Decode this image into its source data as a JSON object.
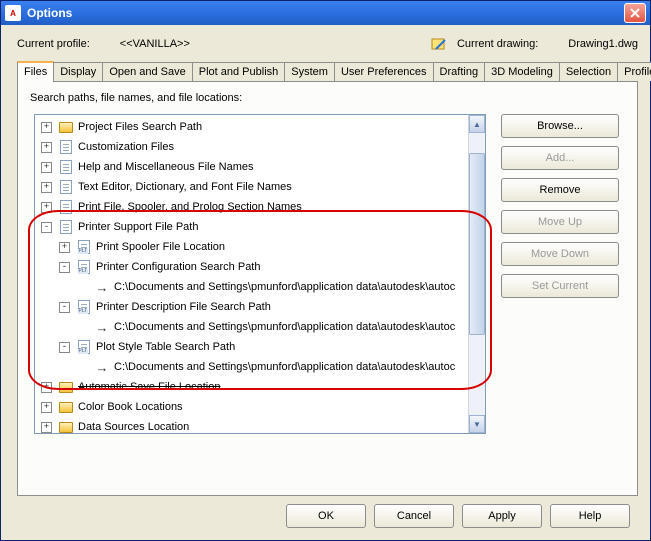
{
  "window": {
    "title": "Options"
  },
  "profile": {
    "label": "Current profile:",
    "name": "<<VANILLA>>",
    "drawing_label": "Current drawing:",
    "drawing_name": "Drawing1.dwg"
  },
  "tabs": [
    {
      "label": "Files",
      "active": true
    },
    {
      "label": "Display"
    },
    {
      "label": "Open and Save"
    },
    {
      "label": "Plot and Publish"
    },
    {
      "label": "System"
    },
    {
      "label": "User Preferences"
    },
    {
      "label": "Drafting"
    },
    {
      "label": "3D Modeling"
    },
    {
      "label": "Selection"
    },
    {
      "label": "Profiles"
    }
  ],
  "panel": {
    "caption": "Search paths, file names, and file locations:"
  },
  "tree": [
    {
      "indent": 0,
      "toggle": "+",
      "icon": "folder-y",
      "label": "Project Files Search Path"
    },
    {
      "indent": 0,
      "toggle": "+",
      "icon": "page",
      "label": "Customization Files"
    },
    {
      "indent": 0,
      "toggle": "+",
      "icon": "page",
      "label": "Help and Miscellaneous File Names"
    },
    {
      "indent": 0,
      "toggle": "+",
      "icon": "page",
      "label": "Text Editor, Dictionary, and Font File Names"
    },
    {
      "indent": 0,
      "toggle": "+",
      "icon": "page",
      "label": "Print File, Spooler, and Prolog Section Names"
    },
    {
      "indent": 0,
      "toggle": "-",
      "icon": "page",
      "label": "Printer Support File Path"
    },
    {
      "indent": 1,
      "toggle": "+",
      "icon": "page-plt",
      "label": "Print Spooler File Location"
    },
    {
      "indent": 1,
      "toggle": "-",
      "icon": "page-plt",
      "label": "Printer Configuration Search Path"
    },
    {
      "indent": 2,
      "toggle": "",
      "icon": "arrow",
      "label": "C:\\Documents and Settings\\pmunford\\application data\\autodesk\\autoc"
    },
    {
      "indent": 1,
      "toggle": "-",
      "icon": "page-plt",
      "label": "Printer Description File Search Path"
    },
    {
      "indent": 2,
      "toggle": "",
      "icon": "arrow",
      "label": "C:\\Documents and Settings\\pmunford\\application data\\autodesk\\autoc"
    },
    {
      "indent": 1,
      "toggle": "-",
      "icon": "page-plt",
      "label": "Plot Style Table Search Path"
    },
    {
      "indent": 2,
      "toggle": "",
      "icon": "arrow",
      "label": "C:\\Documents and Settings\\pmunford\\application data\\autodesk\\autoc"
    },
    {
      "indent": 0,
      "toggle": "+",
      "icon": "folder-y",
      "label": "Automatic Save File Location",
      "strike": true
    },
    {
      "indent": 0,
      "toggle": "+",
      "icon": "folder-y",
      "label": "Color Book Locations"
    },
    {
      "indent": 0,
      "toggle": "+",
      "icon": "folder-y",
      "label": "Data Sources Location"
    }
  ],
  "buttons": {
    "browse": "Browse...",
    "add": "Add...",
    "remove": "Remove",
    "moveup": "Move Up",
    "movedown": "Move Down",
    "setcurrent": "Set Current"
  },
  "footer": {
    "ok": "OK",
    "cancel": "Cancel",
    "apply": "Apply",
    "help": "Help"
  }
}
